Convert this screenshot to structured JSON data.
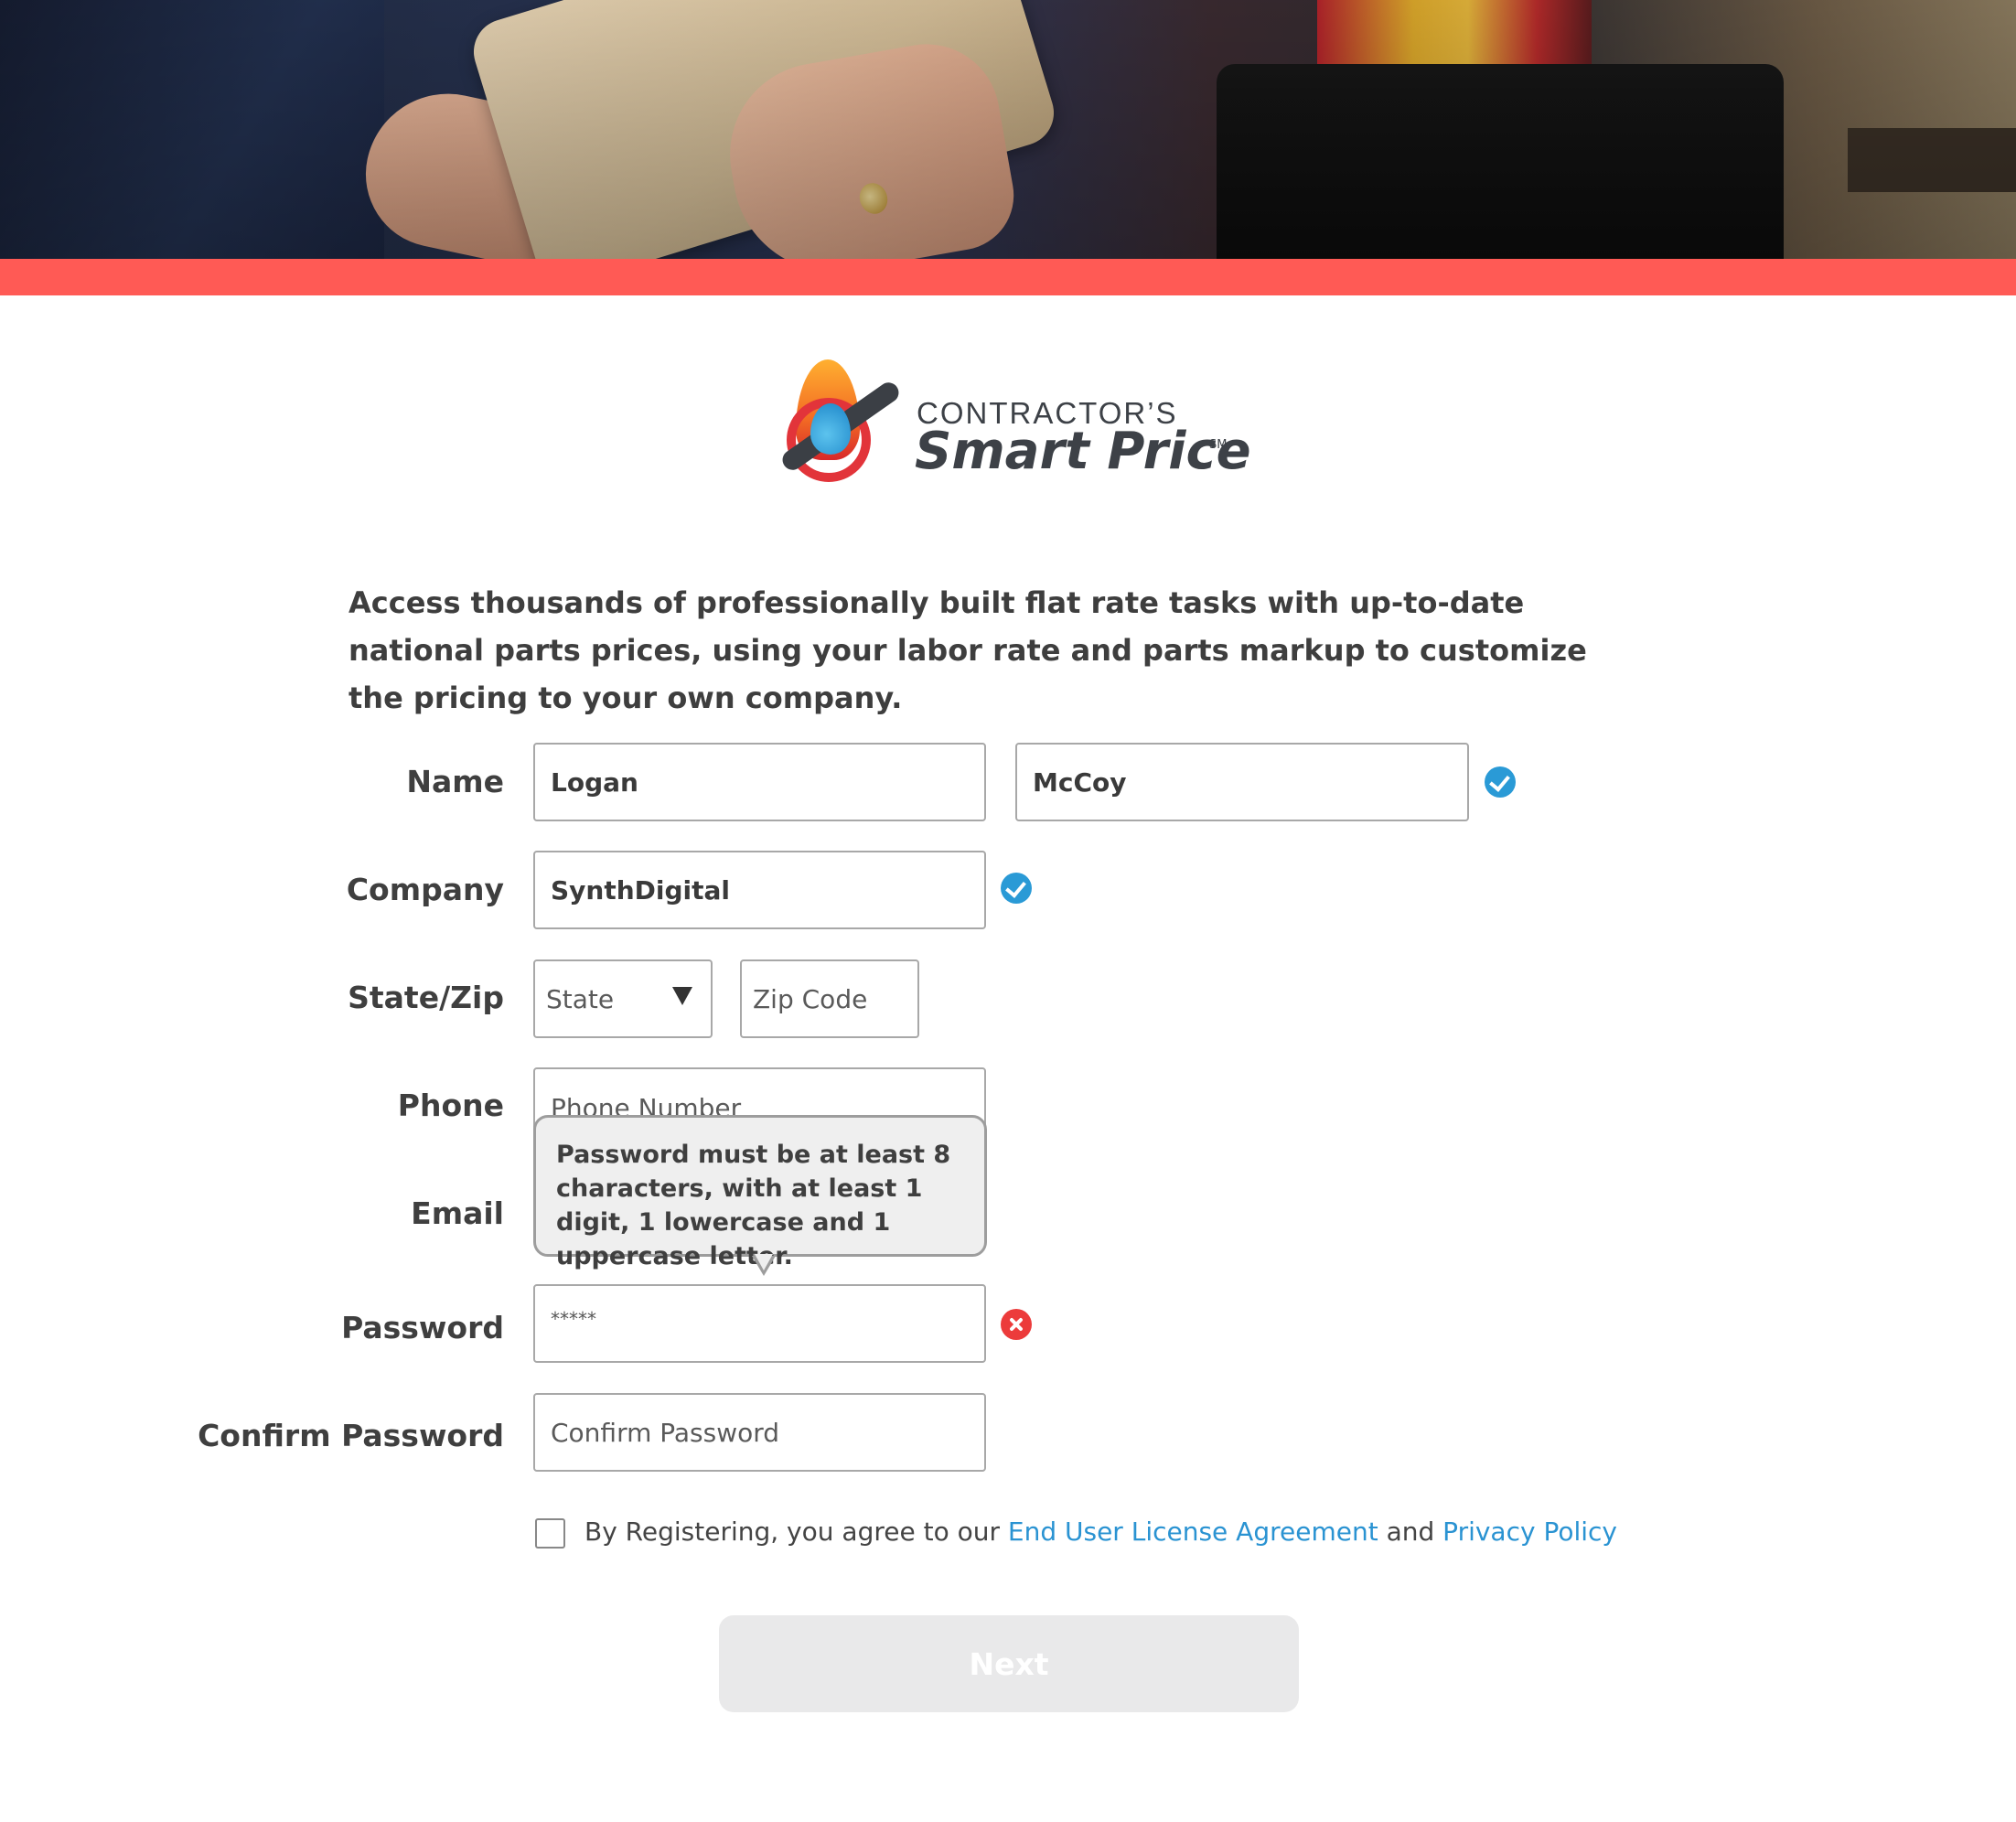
{
  "brand": {
    "line1": "CONTRACTOR’S",
    "line2": "Smart Price",
    "service_mark": "SM",
    "colors": {
      "accent_bar": "#ff5a55",
      "link": "#2a93d2",
      "valid": "#2a9ad6",
      "error": "#ec3b3b"
    }
  },
  "intro": "Access thousands of professionally built flat rate tasks with up-to-date national parts prices, using your labor rate and parts markup to customize the pricing to your own company.",
  "form": {
    "name": {
      "label": "Name",
      "first": "Logan",
      "last": "McCoy"
    },
    "company": {
      "label": "Company",
      "value": "SynthDigital"
    },
    "state_zip": {
      "label": "State/Zip",
      "state_selected": "State",
      "zip_placeholder": "Zip Code"
    },
    "phone": {
      "label": "Phone",
      "placeholder": "Phone Number"
    },
    "email": {
      "label": "Email"
    },
    "password": {
      "label": "Password",
      "value": "*****"
    },
    "confirm_password": {
      "label": "Confirm Password",
      "placeholder": "Confirm Password"
    },
    "tooltip": "Password must be at least 8 characters, with at least 1 digit, 1 lowercase and 1 uppercase letter.",
    "agreement": {
      "prefix": "By Registering, you agree to our ",
      "eula_link": "End User License Agreement",
      "middle": " and ",
      "privacy_link": "Privacy Policy"
    },
    "next_label": "Next"
  },
  "icons": {
    "name_status": "check-circle-icon",
    "company_status": "check-circle-icon",
    "password_status": "error-x-icon",
    "state_dropdown": "caret-down-icon"
  }
}
